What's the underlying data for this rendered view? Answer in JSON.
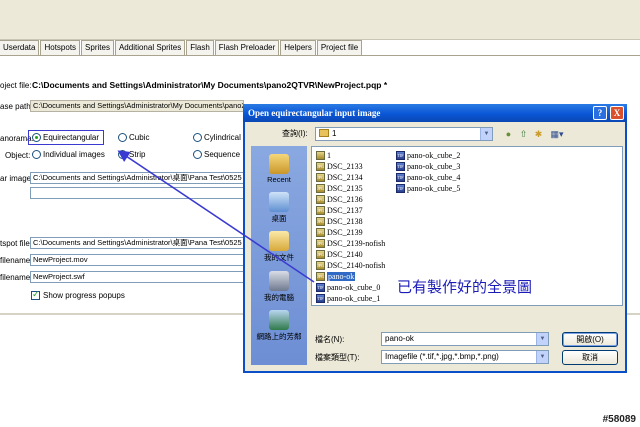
{
  "tabs": [
    "Userdata",
    "Hotspots",
    "Sprites",
    "Additional Sprites",
    "Flash",
    "Flash Preloader",
    "Helpers",
    "Project file"
  ],
  "form": {
    "project_file_label": "oject file:",
    "project_file_value": "C:\\Documents and Settings\\Administrator\\My Documents\\pano2QTVR\\NewProject.pqp *",
    "base_path_label": "ase path:",
    "base_path_value": "C:\\Documents and Settings\\Administrator\\My Documents\\pano2",
    "panorama_label": "anorama:",
    "panorama_options": [
      "Equirectangular",
      "Cubic",
      "Cylindrical"
    ],
    "object_label": "Object:",
    "object_options": [
      "Individual images",
      "Strip",
      "Sequence"
    ],
    "image_label": "ar image:",
    "image_value": "C:\\Documents and Settings\\Administrator\\桌面\\Pana Test\\0525",
    "output_label": "tspot file:",
    "output_value": "C:\\Documents and Settings\\Administrator\\桌面\\Pana Test\\0525",
    "mov_label": "filename:",
    "mov_value": "NewProject.mov",
    "swf_label": "filename:",
    "swf_value": "NewProject.swf",
    "popups_label": "Show progress popups"
  },
  "dialog": {
    "title": "Open equirectangular input image",
    "help_button": "?",
    "close_button": "X",
    "lookin_label": "查詢(I):",
    "lookin_value": "1",
    "places": [
      "Recent",
      "桌面",
      "我的文件",
      "我的電腦",
      "網路上的芳鄰"
    ],
    "files_col1": [
      "1",
      "DSC_2133",
      "DSC_2134",
      "DSC_2135",
      "DSC_2136",
      "DSC_2137",
      "DSC_2138",
      "DSC_2139",
      "DSC_2139-nofish",
      "DSC_2140",
      "DSC_2140-nofish",
      "pano-ok",
      "pano-ok_cube_0",
      "pano-ok_cube_1"
    ],
    "files_col2": [
      "pano-ok_cube_2",
      "pano-ok_cube_3",
      "pano-ok_cube_4",
      "pano-ok_cube_5"
    ],
    "selected_file": "pano-ok",
    "filename_label": "檔名(N):",
    "filename_value": "pano-ok",
    "filetype_label": "檔案類型(T):",
    "filetype_value": "Imagefile (*.tif,*.jpg,*.bmp,*.png)",
    "open_button": "開啟(O)",
    "cancel_button": "取消"
  },
  "annotation": "已有製作好的全景圖",
  "watermark": "#58089",
  "colors": {
    "title_bar": "#0a56d6",
    "annotation": "#1b1bb8",
    "selection": "#316ac5"
  }
}
